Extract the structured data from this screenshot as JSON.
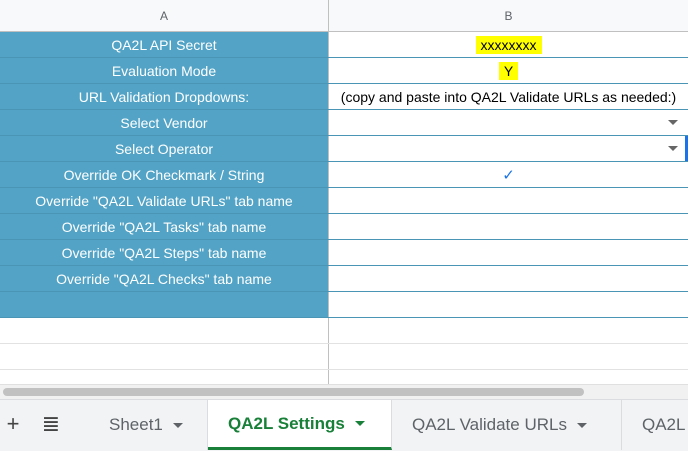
{
  "columns": {
    "a": "A",
    "b": "B"
  },
  "rows": [
    {
      "label": "QA2L API Secret",
      "value": "xxxxxxxx"
    },
    {
      "label": "Evaluation Mode",
      "value": "Y"
    },
    {
      "label": "URL Validation Dropdowns:",
      "value": "(copy and paste into QA2L Validate URLs as needed:)"
    },
    {
      "label": "Select Vendor",
      "value": ""
    },
    {
      "label": "Select Operator",
      "value": ""
    },
    {
      "label": "Override OK Checkmark / String",
      "value": "✓"
    },
    {
      "label": "Override \"QA2L Validate URLs\" tab name",
      "value": ""
    },
    {
      "label": "Override \"QA2L Tasks\" tab name",
      "value": ""
    },
    {
      "label": "Override \"QA2L Steps\" tab name",
      "value": ""
    },
    {
      "label": "Override \"QA2L Checks\" tab name",
      "value": ""
    }
  ],
  "tabbar": {
    "add_icon": "+",
    "menu_icon": "≣",
    "tabs": [
      {
        "label": "Sheet1"
      },
      {
        "label": "QA2L Settings"
      },
      {
        "label": "QA2L Validate URLs"
      },
      {
        "label": "QA2L"
      }
    ],
    "active_tab": "QA2L Settings"
  },
  "colors": {
    "label_bg": "#52a3c6",
    "highlight": "#ffff00",
    "active_tab": "#188038",
    "checkmark": "#1a73e8"
  }
}
